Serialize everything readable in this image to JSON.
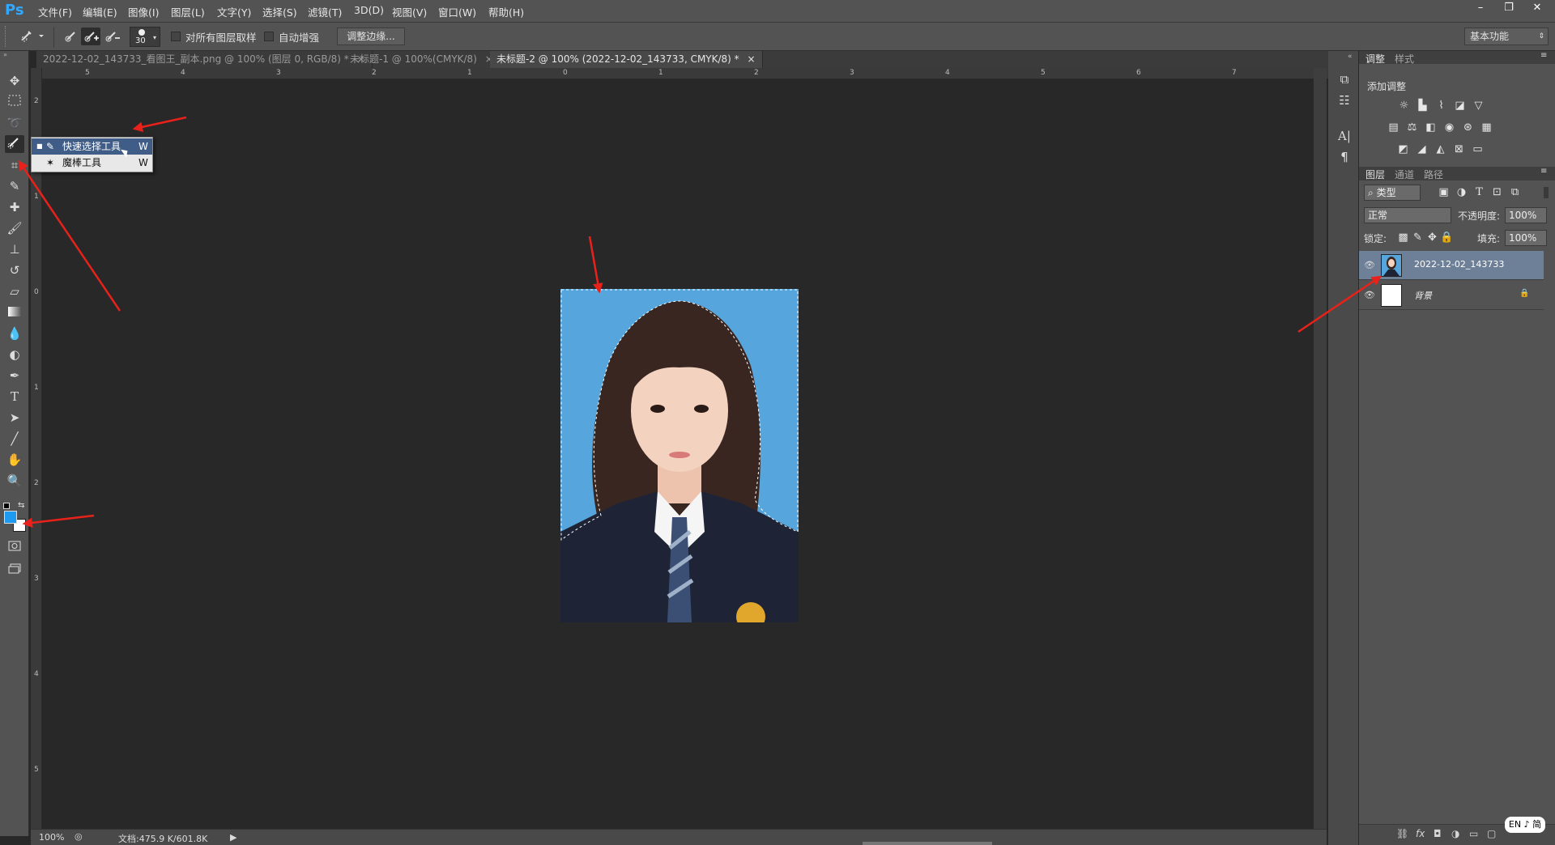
{
  "app": {
    "logo": "Ps"
  },
  "menubar": {
    "items": [
      "文件(F)",
      "编辑(E)",
      "图像(I)",
      "图层(L)",
      "文字(Y)",
      "选择(S)",
      "滤镜(T)",
      "3D(D)",
      "视图(V)",
      "窗口(W)",
      "帮助(H)"
    ]
  },
  "window_controls": {
    "minimize": "–",
    "restore": "❐",
    "close": "✕"
  },
  "options_bar": {
    "brush_size": "30",
    "sample_all_layers": "对所有图层取样",
    "auto_enhance": "自动增强",
    "refine_edge": "调整边缘...",
    "workspace": "基本功能"
  },
  "doc_tabs": [
    {
      "label": "2022-12-02_143733_看图王_副本.png @ 100% (图层 0, RGB/8) *",
      "active": false
    },
    {
      "label": "未标题-1 @ 100%(CMYK/8)",
      "active": false
    },
    {
      "label": "未标题-2 @ 100% (2022-12-02_143733, CMYK/8) *",
      "active": true
    }
  ],
  "ruler_top": [
    "5",
    "4",
    "3",
    "2",
    "1",
    "0",
    "1",
    "2",
    "3",
    "4",
    "5",
    "6",
    "7"
  ],
  "ruler_left": [
    "2",
    "1",
    "0",
    "1",
    "2",
    "3",
    "4",
    "5"
  ],
  "flyout": {
    "items": [
      {
        "label": "快速选择工具",
        "key": "W"
      },
      {
        "label": "魔棒工具",
        "key": "W"
      }
    ]
  },
  "status": {
    "zoom": "100%",
    "doc": "文档:475.9 K/601.8K"
  },
  "adjustments": {
    "tab": "调整",
    "tab2": "样式",
    "title": "添加调整"
  },
  "layers_panel": {
    "tabs": [
      "图层",
      "通道",
      "路径"
    ],
    "filter": "类型",
    "blend": "正常",
    "opacity_label": "不透明度:",
    "opacity": "100%",
    "lock_label": "锁定:",
    "fill_label": "填充:",
    "fill": "100%",
    "layers": [
      {
        "name": "2022-12-02_143733",
        "selected": true
      },
      {
        "name": "背景",
        "selected": false
      }
    ]
  },
  "taskbar": {
    "ime": "EN ♪ 简"
  },
  "colors": {
    "accent": "#31a8ff",
    "arrow": "#e8221b",
    "photo_bg": "#56a6dd",
    "fg_swatch": "#1e9bf0"
  }
}
